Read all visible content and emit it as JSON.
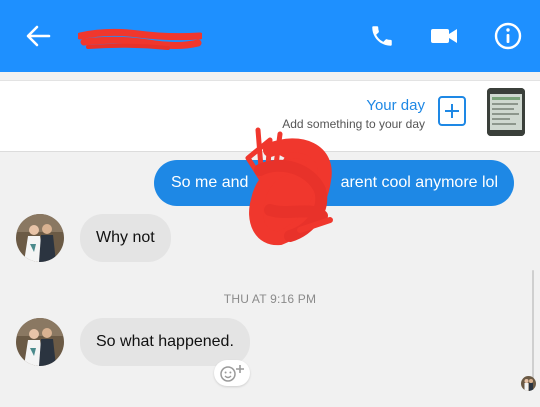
{
  "header": {
    "contact_name_redacted": true,
    "icons": [
      "back-arrow-icon",
      "phone-icon",
      "video-camera-icon",
      "info-icon"
    ]
  },
  "your_day": {
    "title": "Your day",
    "subtitle": "Add something to your day"
  },
  "messages": [
    {
      "direction": "outgoing",
      "text_left": "So me and",
      "text_right": "arent cool anymore lol",
      "redacted_middle": true
    },
    {
      "direction": "incoming",
      "text": "Why not"
    },
    {
      "direction": "incoming",
      "text": "So what happened."
    }
  ],
  "timestamp": "THU AT 9:16 PM",
  "colors": {
    "header": "#1e90ff",
    "outgoing_bubble": "#1e88e5",
    "incoming_bubble": "#e4e4e4",
    "redaction": "#f0372d"
  }
}
